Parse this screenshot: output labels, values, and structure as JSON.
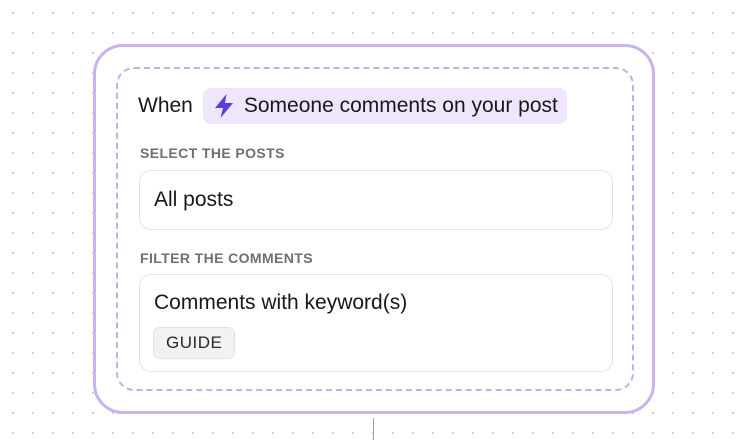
{
  "trigger": {
    "when_label": "When",
    "event_icon": "lightning-bolt-icon",
    "event_label": "Someone comments on your post"
  },
  "posts_section": {
    "label": "SELECT THE POSTS",
    "value": "All posts"
  },
  "comments_section": {
    "label": "FILTER THE COMMENTS",
    "value": "Comments with keyword(s)",
    "keywords": [
      "GUIDE"
    ]
  },
  "colors": {
    "card_border": "#c9b3ec",
    "chip_background": "#efe6fb",
    "bolt_icon": "#5b3fd9"
  }
}
